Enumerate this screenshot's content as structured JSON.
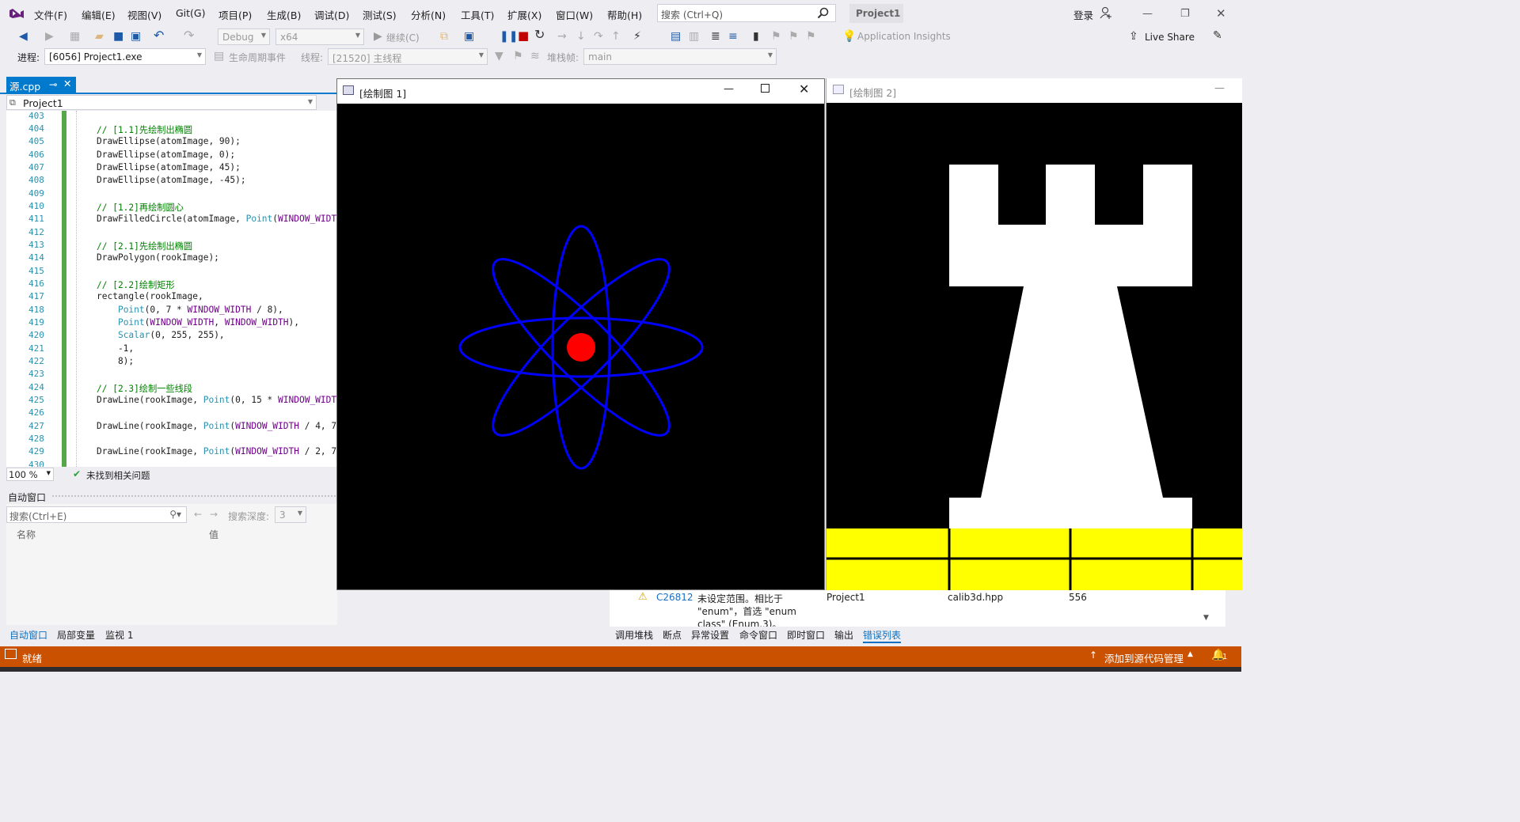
{
  "menu": {
    "items": [
      "文件(F)",
      "编辑(E)",
      "视图(V)",
      "Git(G)",
      "项目(P)",
      "生成(B)",
      "调试(D)",
      "测试(S)",
      "分析(N)",
      "工具(T)",
      "扩展(X)",
      "窗口(W)",
      "帮助(H)"
    ],
    "search_placeholder": "搜索 (Ctrl+Q)",
    "solution": "Project1",
    "login": "登录"
  },
  "toolbar": {
    "config": "Debug",
    "platform": "x64",
    "continue_label": "继续(C)",
    "app_insights": "Application Insights",
    "live_share": "Live Share"
  },
  "debug_location": {
    "process_label": "进程:",
    "process": "[6056] Project1.exe",
    "lifecycle_label": "生命周期事件",
    "thread_label": "线程:",
    "thread": "[21520] 主线程",
    "stack_label": "堆栈帧:",
    "stack_frame": "main"
  },
  "editor": {
    "tab_label": "源.cpp",
    "nav_project": "Project1",
    "zoom": "100 %",
    "issues": "未找到相关问题",
    "line_numbers": [
      "403",
      "404",
      "405",
      "406",
      "407",
      "408",
      "409",
      "410",
      "411",
      "412",
      "413",
      "414",
      "415",
      "416",
      "417",
      "418",
      "419",
      "420",
      "421",
      "422",
      "423",
      "424",
      "425",
      "426",
      "427",
      "428",
      "429",
      "430"
    ]
  },
  "autos": {
    "title": "自动窗口",
    "search_placeholder": "搜索(Ctrl+E)",
    "depth_label": "搜索深度:",
    "depth_value": "3",
    "col_name": "名称",
    "col_value": "值"
  },
  "bottom_tabs_left": [
    "自动窗口",
    "局部变量",
    "监视 1"
  ],
  "bottom_tabs_right": [
    "调用堆栈",
    "断点",
    "异常设置",
    "命令窗口",
    "即时窗口",
    "输出",
    "错误列表"
  ],
  "error_row": {
    "code": "C26812",
    "message_1": "未设定范围。相比于",
    "message_2": "\"enum\"，首选 \"enum",
    "message_3": "class\" (Enum.3)。",
    "project": "Project1",
    "file": "calib3d.hpp",
    "line": "556"
  },
  "window1": {
    "title": "[绘制图 1]"
  },
  "window2": {
    "title": "[绘制图 2]"
  },
  "status": {
    "ready": "就绪",
    "source_control": "添加到源代码管理",
    "notifications": "1"
  },
  "colors": {
    "accent": "#007acc",
    "statusbar": "#ca5100",
    "ellipse": "#0000ff",
    "circle": "#ff0000",
    "rook": "#ffffff",
    "rect": "#ffff00"
  }
}
